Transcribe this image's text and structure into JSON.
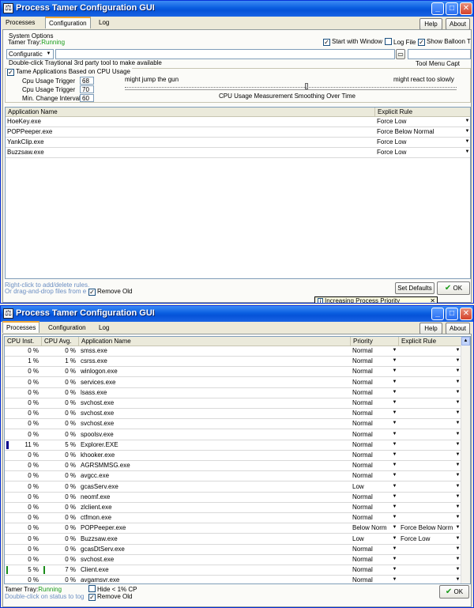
{
  "window1": {
    "title": "Process Tamer Configuration GUI",
    "tabs": [
      "Processes",
      "Configuration",
      "Log"
    ],
    "help_label": "Help",
    "about_label": "About",
    "system_options_label": "System Options",
    "tamer_tray_label": "Tamer Tray:",
    "tamer_tray_status": "Running",
    "start_with_windows_label": "Start with Window",
    "log_file_label": "Log File",
    "show_balloon_label": "Show Balloon T",
    "config_dropdown_value": "Configuratic",
    "path_input_value": "",
    "double_click_text": "Double-click Traytional 3rd party tool to make available",
    "tool_menu_caption": "Tool Menu Capt",
    "tame_cpu_label": "Tame Applications Based on CPU Usage",
    "cpu_trigger1_label": "Cpu Usage Trigger",
    "cpu_trigger1_value": "68",
    "cpu_trigger2_label": "Cpu Usage Trigger",
    "cpu_trigger2_value": "70",
    "min_change_label": "Min. Change Interval",
    "min_change_value": "60",
    "slider_left_label": "might jump the gun",
    "slider_right_label": "might react too slowly",
    "slider_caption": "CPU Usage Measurement Smoothing Over Time",
    "table_headers": [
      "Application Name",
      "Explicit Rule"
    ],
    "rules": [
      {
        "name": "HoeKey.exe",
        "rule": "Force Low"
      },
      {
        "name": "POPPeeper.exe",
        "rule": "Force Below Normal"
      },
      {
        "name": "YankClip.exe",
        "rule": "Force Low"
      },
      {
        "name": "Buzzsaw.exe",
        "rule": "Force Low"
      }
    ],
    "hint1": "Right-click to add/delete rules.",
    "hint2": "Or drag-and-drop files from e",
    "remove_old_label": "Remove Old",
    "set_defaults_label": "Set Defaults",
    "ok_label": "OK",
    "balloon_text": "Increasing Process Priority"
  },
  "window2": {
    "title": "Process Tamer Configuration GUI",
    "tabs": [
      "Processes",
      "Configuration",
      "Log"
    ],
    "help_label": "Help",
    "about_label": "About",
    "table_headers": [
      "CPU Inst.",
      "CPU Avg.",
      "Application Name",
      "Priority",
      "Explicit Rule"
    ],
    "processes": [
      {
        "inst": "0 %",
        "avg": "0 %",
        "name": "smss.exe",
        "priority": "Normal",
        "rule": ""
      },
      {
        "inst": "1 %",
        "avg": "1 %",
        "name": "csrss.exe",
        "priority": "Normal",
        "rule": ""
      },
      {
        "inst": "0 %",
        "avg": "0 %",
        "name": "winlogon.exe",
        "priority": "Normal",
        "rule": ""
      },
      {
        "inst": "0 %",
        "avg": "0 %",
        "name": "services.exe",
        "priority": "Normal",
        "rule": ""
      },
      {
        "inst": "0 %",
        "avg": "0 %",
        "name": "lsass.exe",
        "priority": "Normal",
        "rule": ""
      },
      {
        "inst": "0 %",
        "avg": "0 %",
        "name": "svchost.exe",
        "priority": "Normal",
        "rule": ""
      },
      {
        "inst": "0 %",
        "avg": "0 %",
        "name": "svchost.exe",
        "priority": "Normal",
        "rule": ""
      },
      {
        "inst": "0 %",
        "avg": "0 %",
        "name": "svchost.exe",
        "priority": "Normal",
        "rule": ""
      },
      {
        "inst": "0 %",
        "avg": "0 %",
        "name": "spoolsv.exe",
        "priority": "Normal",
        "rule": ""
      },
      {
        "inst": "11 %",
        "avg": "5 %",
        "name": "Explorer.EXE",
        "priority": "Normal",
        "rule": "",
        "bar": "inst"
      },
      {
        "inst": "0 %",
        "avg": "0 %",
        "name": "khooker.exe",
        "priority": "Normal",
        "rule": ""
      },
      {
        "inst": "0 %",
        "avg": "0 %",
        "name": "AGRSMMSG.exe",
        "priority": "Normal",
        "rule": ""
      },
      {
        "inst": "0 %",
        "avg": "0 %",
        "name": "avgcc.exe",
        "priority": "Normal",
        "rule": ""
      },
      {
        "inst": "0 %",
        "avg": "0 %",
        "name": "gcasServ.exe",
        "priority": "Low",
        "rule": ""
      },
      {
        "inst": "0 %",
        "avg": "0 %",
        "name": "neomf.exe",
        "priority": "Normal",
        "rule": ""
      },
      {
        "inst": "0 %",
        "avg": "0 %",
        "name": "zlclient.exe",
        "priority": "Normal",
        "rule": ""
      },
      {
        "inst": "0 %",
        "avg": "0 %",
        "name": "ctfmon.exe",
        "priority": "Normal",
        "rule": ""
      },
      {
        "inst": "0 %",
        "avg": "0 %",
        "name": "POPPeeper.exe",
        "priority": "Below Norm",
        "rule": "Force Below Norm"
      },
      {
        "inst": "0 %",
        "avg": "0 %",
        "name": "Buzzsaw.exe",
        "priority": "Low",
        "rule": "Force Low"
      },
      {
        "inst": "0 %",
        "avg": "0 %",
        "name": "gcasDtServ.exe",
        "priority": "Normal",
        "rule": ""
      },
      {
        "inst": "0 %",
        "avg": "0 %",
        "name": "svchost.exe",
        "priority": "Normal",
        "rule": ""
      },
      {
        "inst": "5 %",
        "avg": "7 %",
        "name": "Client.exe",
        "priority": "Normal",
        "rule": "",
        "bar": "both"
      },
      {
        "inst": "0 %",
        "avg": "0 %",
        "name": "avgamsvr.exe",
        "priority": "Normal",
        "rule": ""
      }
    ],
    "tamer_tray_label": "Tamer Tray:",
    "tamer_tray_status": "Running",
    "double_click_hint": "Double-click on status to tog",
    "hide_label": "Hide < 1% CP",
    "remove_old_label": "Remove Old",
    "ok_label": "OK"
  }
}
